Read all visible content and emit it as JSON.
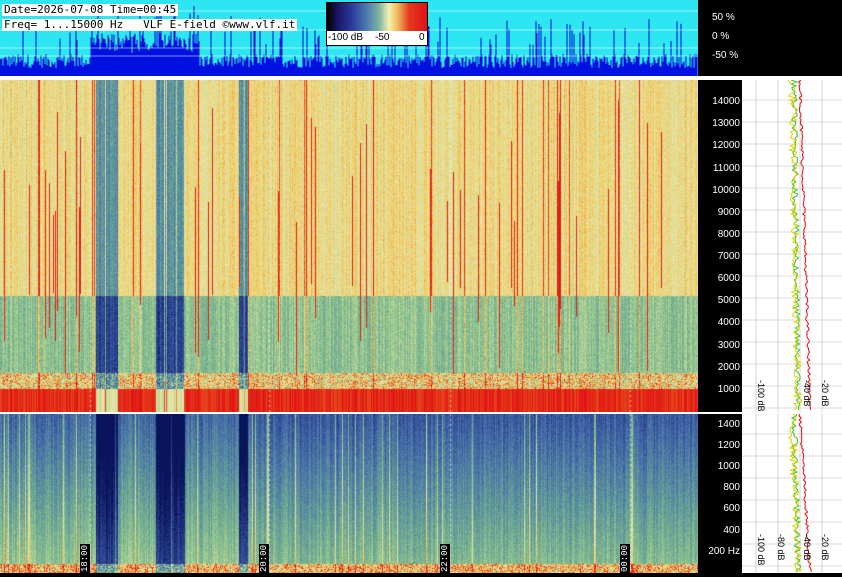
{
  "header": {
    "line1": "Date=2026-07-08 Time=00:45",
    "line2": "Freq= 1...15000 Hz   VLF E-field ©www.vlf.it"
  },
  "color_scale": {
    "labels": [
      "-100 dB",
      "-50",
      "0"
    ],
    "colors": [
      "#000000",
      "#1a1a6b",
      "#2a3a9a",
      "#4c7db0",
      "#7fb3a0",
      "#f4f0b0",
      "#f0c060",
      "#e63a1c",
      "#e0101a"
    ]
  },
  "amplitude_axis": {
    "ticks": [
      "50 %",
      "0 %",
      "-50 %"
    ]
  },
  "colors": {
    "amp_bg": "#2de6f2",
    "amp_trace": "#0010e0",
    "separator": "#ffffff",
    "profile_green": "#30c030",
    "profile_red": "#e01010",
    "profile_yellow": "#e0d000"
  },
  "chart_data": [
    {
      "type": "heatmap",
      "title": "",
      "ylabel": "",
      "y_ticks": [
        1000,
        2000,
        3000,
        4000,
        5000,
        6000,
        7000,
        8000,
        9000,
        10000,
        11000,
        12000,
        13000,
        14000
      ],
      "ylim": [
        0,
        15000
      ],
      "x_ticks": [
        "18:00",
        "20:00",
        "22:00",
        "00:00"
      ],
      "colorbar": {
        "min": -100,
        "max": 0,
        "unit": "dB"
      }
    },
    {
      "type": "heatmap",
      "title": "",
      "ylabel": "",
      "y_ticks": [
        "200 Hz",
        "400",
        "600",
        "800",
        "1000",
        "1200",
        "1400"
      ],
      "ylim": [
        0,
        1500
      ],
      "x_ticks": [
        "18:00",
        "20:00",
        "22:00",
        "00:00"
      ]
    },
    {
      "type": "line",
      "title": "",
      "xlabel": "",
      "x_tick_labels": [
        "-100 dB",
        "-40 dB",
        "-20 dB"
      ]
    },
    {
      "type": "line",
      "title": "",
      "xlabel": "",
      "x_tick_labels": [
        "-100 dB",
        "-80 dB",
        "-40 dB",
        "-20 dB"
      ]
    }
  ],
  "time_labels": [
    "18:00",
    "20:00",
    "22:00",
    "00:00"
  ],
  "upper_freq_labels": [
    "14000",
    "13000",
    "12000",
    "11000",
    "10000",
    "9000",
    "8000",
    "7000",
    "6000",
    "5000",
    "4000",
    "3000",
    "2000",
    "1000"
  ],
  "lower_freq_labels": [
    "1400",
    "1200",
    "1000",
    "800",
    "600",
    "400",
    "200 Hz"
  ],
  "upper_db_labels": [
    "-100 dB",
    "-40 dB",
    "-20 dB"
  ],
  "lower_db_labels": [
    "-100 dB",
    "-80 dB",
    "-40 dB",
    "-20 dB"
  ]
}
